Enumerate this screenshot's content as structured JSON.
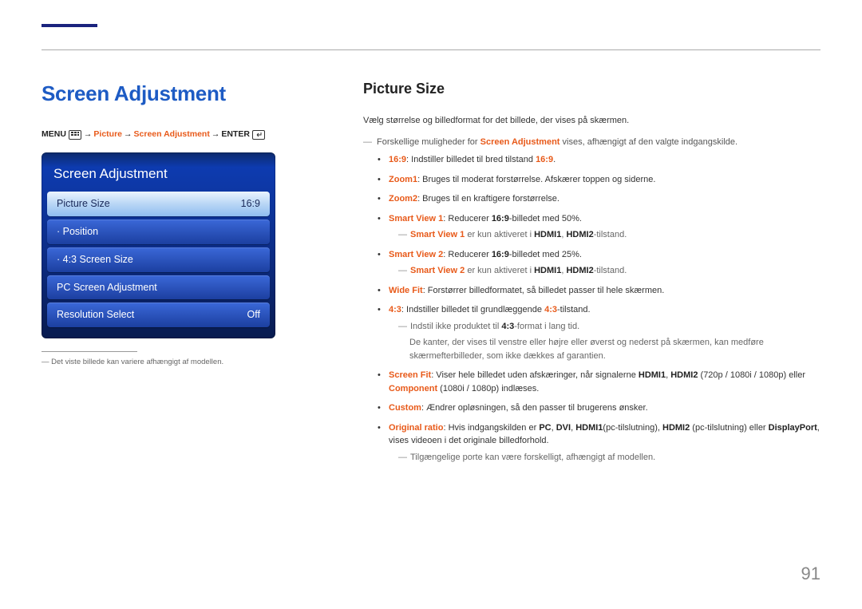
{
  "page_number": "91",
  "left": {
    "heading": "Screen Adjustment",
    "breadcrumb": {
      "menu": "MENU",
      "arrow": "→",
      "picture": "Picture",
      "screen_adjustment": "Screen Adjustment",
      "enter": "ENTER"
    },
    "osd": {
      "title": "Screen Adjustment",
      "rows": [
        {
          "label": "Picture Size",
          "value": "16:9",
          "selected": true
        },
        {
          "label": "· Position",
          "value": "",
          "selected": false
        },
        {
          "label": "· 4:3 Screen Size",
          "value": "",
          "selected": false
        },
        {
          "label": "PC Screen Adjustment",
          "value": "",
          "selected": false
        },
        {
          "label": "Resolution Select",
          "value": "Off",
          "selected": false
        }
      ],
      "note": "Det viste billede kan variere afhængigt af modellen."
    }
  },
  "right": {
    "heading": "Picture Size",
    "intro": "Vælg størrelse og billedformat for det billede, der vises på skærmen.",
    "intro_note_pre": "Forskellige muligheder for ",
    "intro_note_kw": "Screen Adjustment",
    "intro_note_post": " vises, afhængigt af den valgte indgangskilde.",
    "items": {
      "i0": {
        "kw": "16:9",
        "pre": ": Indstiller billedet til bred tilstand ",
        "kw2": "16:9",
        "post": "."
      },
      "i1": {
        "kw": "Zoom1",
        "text": ": Bruges til moderat forstørrelse. Afskærer toppen og siderne."
      },
      "i2": {
        "kw": "Zoom2",
        "text": ": Bruges til en kraftigere forstørrelse."
      },
      "i3": {
        "kw": "Smart View 1",
        "pre": ": Reducerer ",
        "kw2": "16:9",
        "post": "-billedet med 50%.",
        "sub_kw": "Smart View 1",
        "sub_pre": " er kun aktiveret i ",
        "sub_b1": "HDMI1",
        "sub_sep": ", ",
        "sub_b2": "HDMI2",
        "sub_post": "-tilstand."
      },
      "i4": {
        "kw": "Smart View 2",
        "pre": ": Reducerer ",
        "kw2": "16:9",
        "post": "-billedet med 25%.",
        "sub_kw": "Smart View 2",
        "sub_pre": " er kun aktiveret i ",
        "sub_b1": "HDMI1",
        "sub_sep": ", ",
        "sub_b2": "HDMI2",
        "sub_post": "-tilstand."
      },
      "i5": {
        "kw": "Wide Fit",
        "text": ": Forstørrer billedformatet, så billedet passer til hele skærmen."
      },
      "i6": {
        "kw": "4:3",
        "pre": ": Indstiller billedet til grundlæggende ",
        "kw2": "4:3",
        "post": "-tilstand.",
        "sub1_pre": "Indstil ikke produktet til ",
        "sub1_kw": "4:3",
        "sub1_post": "-format i lang tid.",
        "sub2": "De kanter, der vises til venstre eller højre eller øverst og nederst på skærmen, kan medføre skærmefterbilleder, som ikke dækkes af garantien."
      },
      "i7": {
        "kw": "Screen Fit",
        "pre": ": Viser hele billedet uden afskæringer, når signalerne ",
        "b1": "HDMI1",
        "sep1": ", ",
        "b2": "HDMI2",
        "mid": " (720p / 1080i / 1080p) eller ",
        "kw2": "Component",
        "post": " (1080i / 1080p) indlæses."
      },
      "i8": {
        "kw": "Custom",
        "text": ": Ændrer opløsningen, så den passer til brugerens ønsker."
      },
      "i9": {
        "kw": "Original ratio",
        "pre": ": Hvis indgangskilden er ",
        "b1": "PC",
        "s1": ", ",
        "b2": "DVI",
        "s2": ", ",
        "b3": "HDMI1",
        "p1": "(pc-tilslutning), ",
        "b4": "HDMI2",
        "p2": " (pc-tilslutning) eller ",
        "b5": "DisplayPort",
        "post": ", vises videoen i det originale billedforhold.",
        "sub": "Tilgængelige porte kan være forskelligt, afhængigt af modellen."
      }
    }
  }
}
